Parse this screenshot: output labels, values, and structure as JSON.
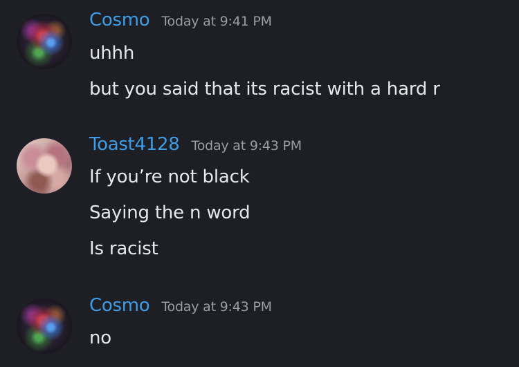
{
  "messages": [
    {
      "username": "Cosmo",
      "timestamp": "Today at 9:41 PM",
      "avatar_icon": "nebula-avatar-icon",
      "lines": [
        "uhhh",
        "but you said that its racist with a hard r"
      ]
    },
    {
      "username": "Toast4128",
      "timestamp": "Today at 9:43 PM",
      "avatar_icon": "anime-avatar-icon",
      "lines": [
        "If you’re not black",
        "Saying the n word",
        "Is racist"
      ]
    },
    {
      "username": "Cosmo",
      "timestamp": "Today at 9:43 PM",
      "avatar_icon": "nebula-avatar-icon",
      "lines": [
        "no"
      ]
    }
  ],
  "colors": {
    "background": "#1e1f24",
    "username": "#3e9be6",
    "timestamp": "#9a9ca6",
    "message_text": "#e7e8ec"
  }
}
